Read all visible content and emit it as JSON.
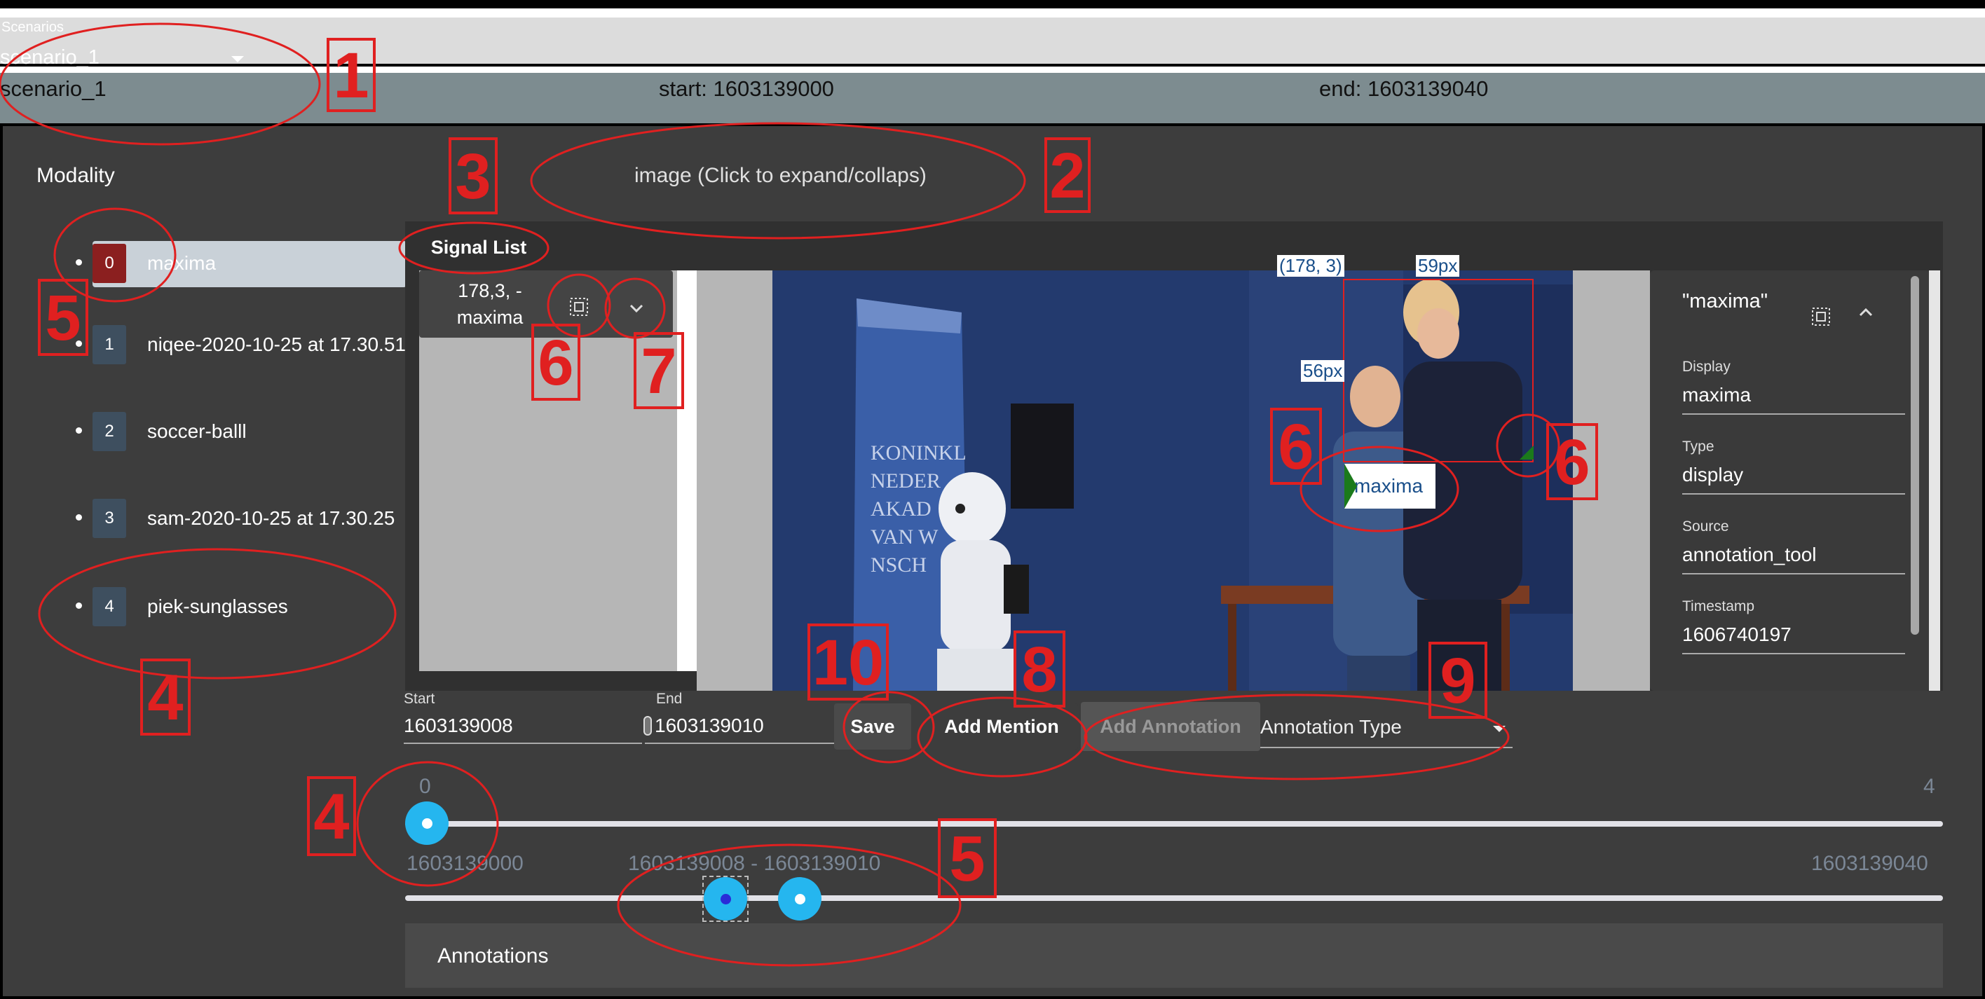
{
  "scenario": {
    "caption": "Scenarios",
    "selected": "scenario_1",
    "name": "scenario_1",
    "start": "start: 1603139000",
    "end": "end: 1603139040"
  },
  "modality": {
    "title": "Modality",
    "expand_label": "image (Click to expand/collaps)"
  },
  "signal_list": {
    "tab_label": "Signal List",
    "items": [
      {
        "index": "0",
        "label": "maxima",
        "selected": true
      },
      {
        "index": "1",
        "label": "niqee-2020-10-25 at 17.30.51"
      },
      {
        "index": "2",
        "label": "soccer-balll"
      },
      {
        "index": "3",
        "label": "sam-2020-10-25 at 17.30.25"
      },
      {
        "index": "4",
        "label": "piek-sunglasses"
      }
    ],
    "card_line1": "178,3, -",
    "card_line2": "maxima"
  },
  "image": {
    "bbox_origin_label": "(178, 3)",
    "bbox_width_label": "59px",
    "bbox_height_label": "56px",
    "mention_tag": "maxima",
    "icons": [
      "select-region-icon",
      "chevron-down-icon",
      "chevron-up-icon"
    ]
  },
  "detail": {
    "title": "\"maxima\"",
    "fields": [
      {
        "label": "Display",
        "value": "maxima"
      },
      {
        "label": "Type",
        "value": "display"
      },
      {
        "label": "Source",
        "value": "annotation_tool"
      },
      {
        "label": "Timestamp",
        "value": "1606740197"
      }
    ]
  },
  "controls": {
    "start_caption": "Start",
    "start_value": "1603139008",
    "end_caption": "End",
    "end_value": "1603139010",
    "save_label": "Save",
    "add_mention_label": "Add Mention",
    "add_annotation_label": "Add Annotation",
    "annotation_type_placeholder": "Annotation Type"
  },
  "sliders": {
    "index_slider": {
      "min_label": "0",
      "max_label": "4",
      "value": 0
    },
    "time_slider": {
      "min_label": "1603139000",
      "max_label": "1603139040",
      "range_label": "1603139008 - 1603139010",
      "range": [
        1603139008,
        1603139010
      ]
    }
  },
  "annotations": {
    "title": "Annotations"
  },
  "markers": [
    "1",
    "2",
    "3",
    "4",
    "5",
    "6",
    "7",
    "8",
    "9",
    "10",
    "4",
    "5",
    "6",
    "6"
  ],
  "colors": {
    "accent": "#25b6ef",
    "marker_red": "#e02020",
    "selected_badge": "#8b1f1f",
    "mention_green": "#1b7a1b"
  }
}
